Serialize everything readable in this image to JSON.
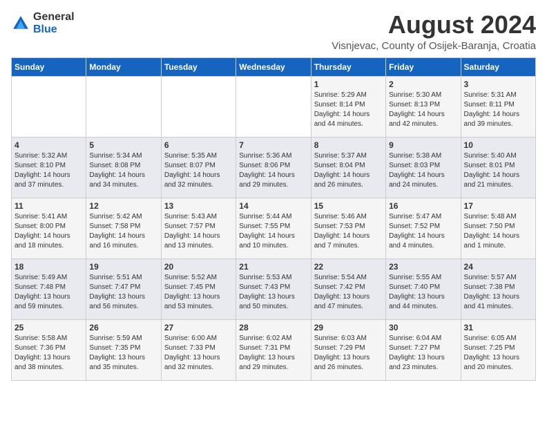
{
  "logo": {
    "general": "General",
    "blue": "Blue"
  },
  "title": {
    "month_year": "August 2024",
    "location": "Visnjevac, County of Osijek-Baranja, Croatia"
  },
  "headers": [
    "Sunday",
    "Monday",
    "Tuesday",
    "Wednesday",
    "Thursday",
    "Friday",
    "Saturday"
  ],
  "weeks": [
    [
      {
        "day": "",
        "content": ""
      },
      {
        "day": "",
        "content": ""
      },
      {
        "day": "",
        "content": ""
      },
      {
        "day": "",
        "content": ""
      },
      {
        "day": "1",
        "content": "Sunrise: 5:29 AM\nSunset: 8:14 PM\nDaylight: 14 hours\nand 44 minutes."
      },
      {
        "day": "2",
        "content": "Sunrise: 5:30 AM\nSunset: 8:13 PM\nDaylight: 14 hours\nand 42 minutes."
      },
      {
        "day": "3",
        "content": "Sunrise: 5:31 AM\nSunset: 8:11 PM\nDaylight: 14 hours\nand 39 minutes."
      }
    ],
    [
      {
        "day": "4",
        "content": "Sunrise: 5:32 AM\nSunset: 8:10 PM\nDaylight: 14 hours\nand 37 minutes."
      },
      {
        "day": "5",
        "content": "Sunrise: 5:34 AM\nSunset: 8:08 PM\nDaylight: 14 hours\nand 34 minutes."
      },
      {
        "day": "6",
        "content": "Sunrise: 5:35 AM\nSunset: 8:07 PM\nDaylight: 14 hours\nand 32 minutes."
      },
      {
        "day": "7",
        "content": "Sunrise: 5:36 AM\nSunset: 8:06 PM\nDaylight: 14 hours\nand 29 minutes."
      },
      {
        "day": "8",
        "content": "Sunrise: 5:37 AM\nSunset: 8:04 PM\nDaylight: 14 hours\nand 26 minutes."
      },
      {
        "day": "9",
        "content": "Sunrise: 5:38 AM\nSunset: 8:03 PM\nDaylight: 14 hours\nand 24 minutes."
      },
      {
        "day": "10",
        "content": "Sunrise: 5:40 AM\nSunset: 8:01 PM\nDaylight: 14 hours\nand 21 minutes."
      }
    ],
    [
      {
        "day": "11",
        "content": "Sunrise: 5:41 AM\nSunset: 8:00 PM\nDaylight: 14 hours\nand 18 minutes."
      },
      {
        "day": "12",
        "content": "Sunrise: 5:42 AM\nSunset: 7:58 PM\nDaylight: 14 hours\nand 16 minutes."
      },
      {
        "day": "13",
        "content": "Sunrise: 5:43 AM\nSunset: 7:57 PM\nDaylight: 14 hours\nand 13 minutes."
      },
      {
        "day": "14",
        "content": "Sunrise: 5:44 AM\nSunset: 7:55 PM\nDaylight: 14 hours\nand 10 minutes."
      },
      {
        "day": "15",
        "content": "Sunrise: 5:46 AM\nSunset: 7:53 PM\nDaylight: 14 hours\nand 7 minutes."
      },
      {
        "day": "16",
        "content": "Sunrise: 5:47 AM\nSunset: 7:52 PM\nDaylight: 14 hours\nand 4 minutes."
      },
      {
        "day": "17",
        "content": "Sunrise: 5:48 AM\nSunset: 7:50 PM\nDaylight: 14 hours\nand 1 minute."
      }
    ],
    [
      {
        "day": "18",
        "content": "Sunrise: 5:49 AM\nSunset: 7:48 PM\nDaylight: 13 hours\nand 59 minutes."
      },
      {
        "day": "19",
        "content": "Sunrise: 5:51 AM\nSunset: 7:47 PM\nDaylight: 13 hours\nand 56 minutes."
      },
      {
        "day": "20",
        "content": "Sunrise: 5:52 AM\nSunset: 7:45 PM\nDaylight: 13 hours\nand 53 minutes."
      },
      {
        "day": "21",
        "content": "Sunrise: 5:53 AM\nSunset: 7:43 PM\nDaylight: 13 hours\nand 50 minutes."
      },
      {
        "day": "22",
        "content": "Sunrise: 5:54 AM\nSunset: 7:42 PM\nDaylight: 13 hours\nand 47 minutes."
      },
      {
        "day": "23",
        "content": "Sunrise: 5:55 AM\nSunset: 7:40 PM\nDaylight: 13 hours\nand 44 minutes."
      },
      {
        "day": "24",
        "content": "Sunrise: 5:57 AM\nSunset: 7:38 PM\nDaylight: 13 hours\nand 41 minutes."
      }
    ],
    [
      {
        "day": "25",
        "content": "Sunrise: 5:58 AM\nSunset: 7:36 PM\nDaylight: 13 hours\nand 38 minutes."
      },
      {
        "day": "26",
        "content": "Sunrise: 5:59 AM\nSunset: 7:35 PM\nDaylight: 13 hours\nand 35 minutes."
      },
      {
        "day": "27",
        "content": "Sunrise: 6:00 AM\nSunset: 7:33 PM\nDaylight: 13 hours\nand 32 minutes."
      },
      {
        "day": "28",
        "content": "Sunrise: 6:02 AM\nSunset: 7:31 PM\nDaylight: 13 hours\nand 29 minutes."
      },
      {
        "day": "29",
        "content": "Sunrise: 6:03 AM\nSunset: 7:29 PM\nDaylight: 13 hours\nand 26 minutes."
      },
      {
        "day": "30",
        "content": "Sunrise: 6:04 AM\nSunset: 7:27 PM\nDaylight: 13 hours\nand 23 minutes."
      },
      {
        "day": "31",
        "content": "Sunrise: 6:05 AM\nSunset: 7:25 PM\nDaylight: 13 hours\nand 20 minutes."
      }
    ]
  ]
}
